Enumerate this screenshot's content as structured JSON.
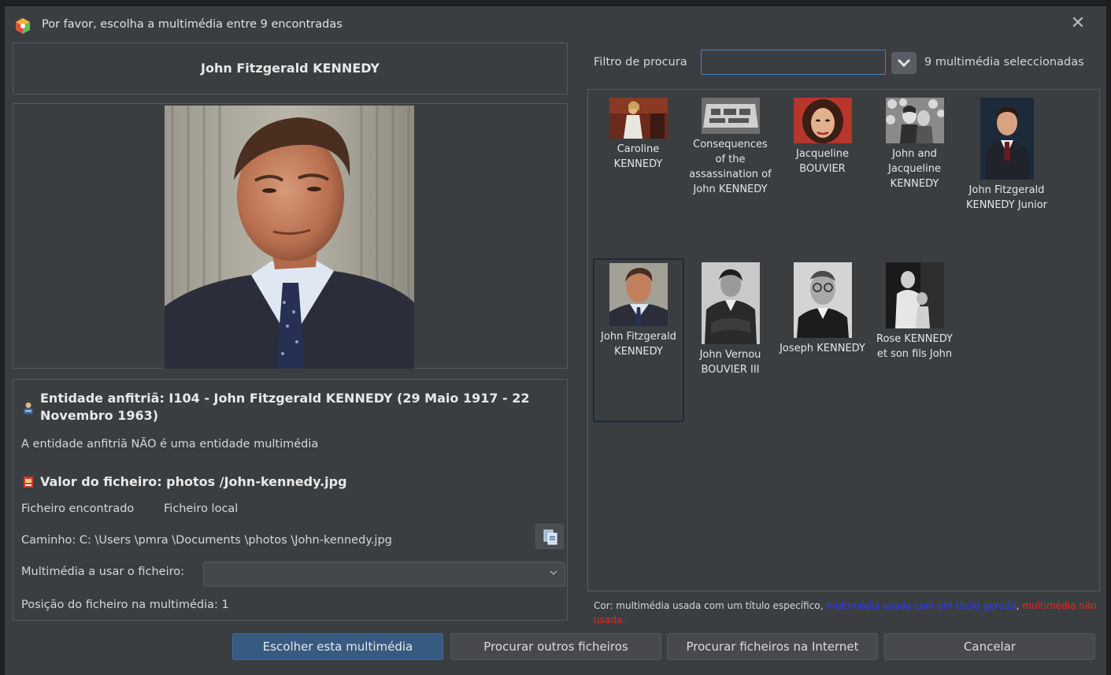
{
  "window": {
    "title": "Por favor, escolha a multimédia entre 9 encontradas",
    "close_glyph": "✕"
  },
  "left": {
    "individual_name": "John Fitzgerald KENNEDY",
    "host_entity": "Entidade anfitriã: I104 - John Fitzgerald KENNEDY (29 Maio 1917 - 22 Novembro 1963)",
    "host_warning": "A entidade anfitriã NÃO é uma entidade multimédia",
    "file_value": "Valor do ficheiro: photos /John-kennedy.jpg",
    "file_found": "Ficheiro encontrado",
    "file_local": "Ficheiro local",
    "path": "Caminho: C: \\Users \\pmra \\Documents \\photos \\John-kennedy.jpg",
    "media_using_label": "Multimédia a usar o ficheiro:",
    "media_using_value": "",
    "file_position": "Posição do ficheiro na multimédia: 1"
  },
  "filter": {
    "label": "Filtro de procura",
    "value": "",
    "selected_count": "9 multimédia seleccionadas"
  },
  "thumbnails": [
    {
      "label": "Caroline KENNEDY",
      "icon": "photo-woman-stage"
    },
    {
      "label": "Consequences of the assassination of John KENNEDY",
      "icon": "photo-document"
    },
    {
      "label": "Jacqueline BOUVIER",
      "icon": "photo-portrait-woman"
    },
    {
      "label": "John and Jacqueline KENNEDY",
      "icon": "photo-couple-bw"
    },
    {
      "label": "John Fitzgerald KENNEDY Junior",
      "icon": "photo-portrait-man"
    },
    {
      "label": "John Fitzgerald KENNEDY",
      "icon": "photo-portrait-jfk",
      "selected": true
    },
    {
      "label": "John Vernou BOUVIER III",
      "icon": "photo-portrait-bw"
    },
    {
      "label": "Joseph KENNEDY",
      "icon": "photo-portrait-bw"
    },
    {
      "label": "Rose KENNEDY et son fils John",
      "icon": "photo-mother-child-bw"
    }
  ],
  "legend": {
    "part1": "Cor: multimédia usada com um título específico, ",
    "part2": "multimédia usada com um título gerado",
    "part3": ", ",
    "part4": "multimédia não usada."
  },
  "buttons": {
    "choose": "Escolher esta multimédia",
    "other_files": "Procurar outros ficheiros",
    "internet": "Procurar ficheiros na Internet",
    "cancel": "Cancelar"
  },
  "colors": {
    "window_bg": "#3b3e41",
    "accent": "#375a80",
    "warning_red": "#e8261e",
    "legend_blue": "#2a3cff"
  }
}
